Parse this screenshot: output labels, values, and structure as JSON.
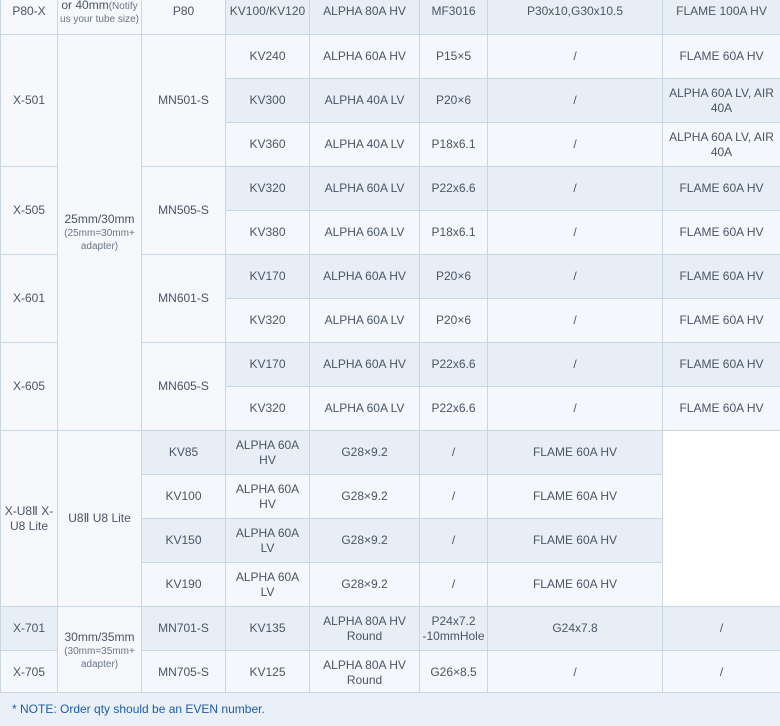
{
  "top": {
    "frame": "P80-X",
    "tube_line1": "or 40mm",
    "tube_line1_small": "(Notify",
    "tube_line2_small": "us your tube size)",
    "motor": "P80",
    "kv": "KV100/KV120",
    "esc": "ALPHA 80A HV",
    "prop": "MF3016",
    "prop2": "P30x10,G30x10.5",
    "esc2": "FLAME 100A HV"
  },
  "tube_group1": {
    "main": "25mm/30mm",
    "small": "(25mm=30mm+ adapter)"
  },
  "tube_group2": {
    "main": "30mm/35mm",
    "small": "(30mm=35mm+ adapter)"
  },
  "rows": [
    {
      "kv": "KV240",
      "esc": "ALPHA 60A HV",
      "prop": "P15×5",
      "prop2": "/",
      "esc2": "FLAME 60A HV"
    },
    {
      "kv": "KV300",
      "esc": "ALPHA 40A LV",
      "prop": "P20×6",
      "prop2": "/",
      "esc2": "ALPHA 60A LV, AIR 40A"
    },
    {
      "kv": "KV360",
      "esc": "ALPHA 40A LV",
      "prop": "P18x6.1",
      "prop2": "/",
      "esc2": "ALPHA 60A LV, AIR 40A"
    },
    {
      "kv": "KV320",
      "esc": "ALPHA 60A LV",
      "prop": "P22x6.6",
      "prop2": "/",
      "esc2": "FLAME 60A HV"
    },
    {
      "kv": "KV380",
      "esc": "ALPHA 60A LV",
      "prop": "P18x6.1",
      "prop2": "/",
      "esc2": "FLAME 60A HV"
    },
    {
      "kv": "KV170",
      "esc": "ALPHA 60A HV",
      "prop": "P20×6",
      "prop2": "/",
      "esc2": "FLAME 60A HV"
    },
    {
      "kv": "KV320",
      "esc": "ALPHA 60A LV",
      "prop": "P20×6",
      "prop2": "/",
      "esc2": "FLAME 60A HV"
    },
    {
      "kv": "KV170",
      "esc": "ALPHA 60A HV",
      "prop": "P22x6.6",
      "prop2": "/",
      "esc2": "FLAME 60A HV"
    },
    {
      "kv": "KV320",
      "esc": "ALPHA 60A LV",
      "prop": "P22x6.6",
      "prop2": "/",
      "esc2": "FLAME 60A HV"
    },
    {
      "kv": "KV85",
      "esc": "ALPHA 60A HV",
      "prop": "G28×9.2",
      "prop2": "/",
      "esc2": "FLAME 60A HV"
    },
    {
      "kv": "KV100",
      "esc": "ALPHA 60A HV",
      "prop": "G28×9.2",
      "prop2": "/",
      "esc2": "FLAME 60A HV"
    },
    {
      "kv": "KV150",
      "esc": "ALPHA 60A LV",
      "prop": "G28×9.2",
      "prop2": "/",
      "esc2": "FLAME 60A HV"
    },
    {
      "kv": "KV190",
      "esc": "ALPHA 60A LV",
      "prop": "G28×9.2",
      "prop2": "/",
      "esc2": "FLAME 60A HV"
    },
    {
      "kv": "KV135",
      "esc": "ALPHA 80A HV Round",
      "prop": "P24x7.2 -10mmHole",
      "prop2": "G24x7.8",
      "esc2": "/"
    },
    {
      "kv": "KV125",
      "esc": "ALPHA 80A HV Round",
      "prop": "G26×8.5",
      "prop2": "/",
      "esc2": "/"
    }
  ],
  "frames": [
    {
      "frame": "X-501",
      "motor": "MN501-S"
    },
    {
      "frame": "X-505",
      "motor": "MN505-S"
    },
    {
      "frame": "X-601",
      "motor": "MN601-S"
    },
    {
      "frame": "X-605",
      "motor": "MN605-S"
    },
    {
      "frame": "X-U8Ⅱ X-U8 Lite",
      "motor": "U8Ⅱ U8 Lite"
    },
    {
      "frame": "X-701",
      "motor": "MN701-S"
    },
    {
      "frame": "X-705",
      "motor": "MN705-S"
    }
  ],
  "note": "* NOTE:  Order qty should be an EVEN number."
}
